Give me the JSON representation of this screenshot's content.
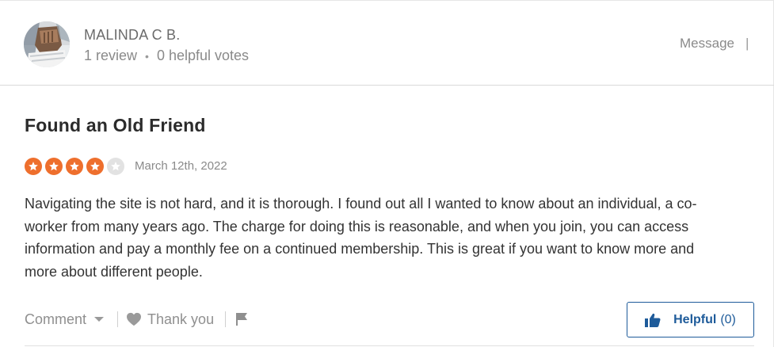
{
  "reviewer": {
    "name": "MALINDA C B.",
    "reviews": "1 review",
    "helpful_votes": "0 helpful votes",
    "message_label": "Message",
    "separator": "|"
  },
  "review": {
    "title": "Found an Old Friend",
    "rating": 4,
    "rating_max": 5,
    "date": "March 12th, 2022",
    "text_lines": [
      "Navigating the site is not hard, and it is thorough. I found out all I wanted to know about an individual, a co-",
      "worker from many years ago. The charge for doing this is reasonable, and when you join, you can access",
      "information and pay a monthly fee on a continued membership. This is great if you want to know more and",
      "more about different people."
    ]
  },
  "actions": {
    "comment_label": "Comment",
    "thank_label": "Thank you",
    "helpful_label": "Helpful",
    "helpful_count": "(0)"
  },
  "colors": {
    "star_filled": "#ee6f2d",
    "star_empty": "#e2e2e2",
    "accent": "#1e5b9a"
  },
  "icons": {
    "comment_caret": "chevron-down-icon",
    "thank": "heart-icon",
    "flag": "flag-icon",
    "helpful": "thumbs-up-icon",
    "star": "star-icon"
  }
}
